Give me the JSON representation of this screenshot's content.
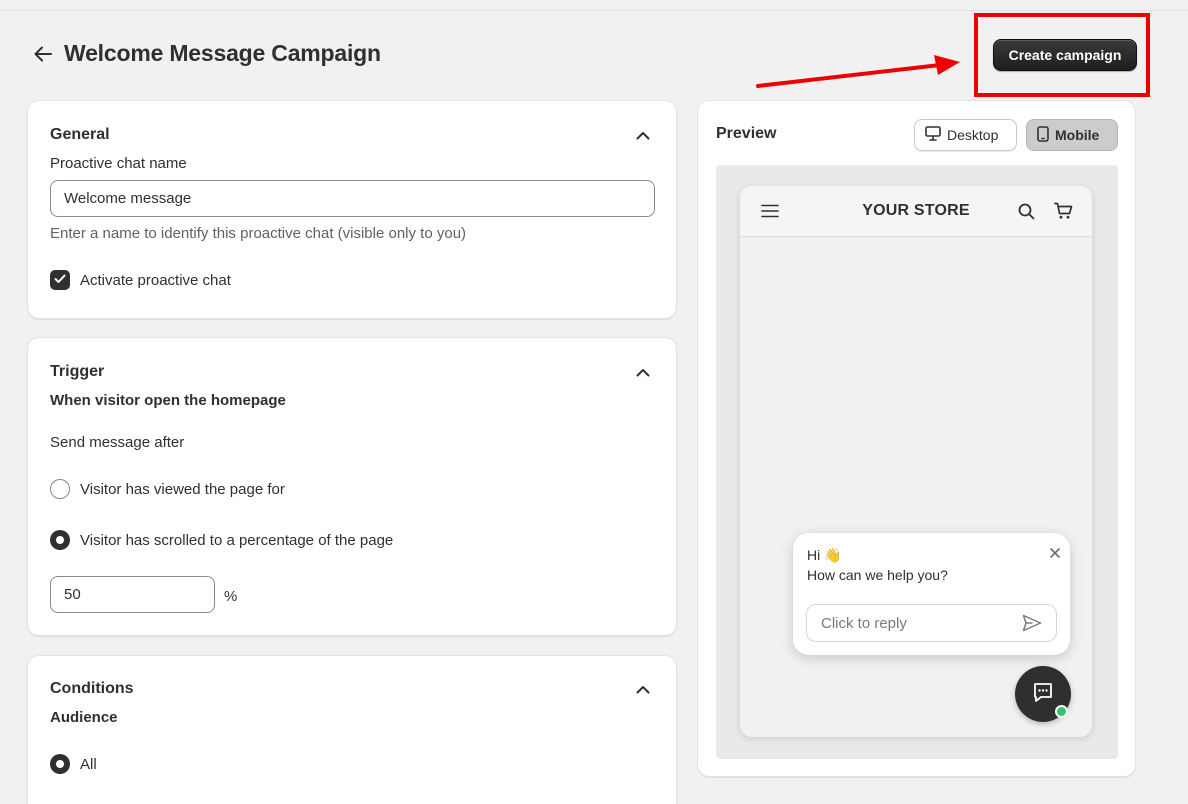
{
  "header": {
    "title": "Welcome Message Campaign",
    "create_button": "Create campaign"
  },
  "general": {
    "title": "General",
    "name_label": "Proactive chat name",
    "name_value": "Welcome message",
    "name_help": "Enter a name to identify this proactive chat (visible only to you)",
    "activate_label": "Activate proactive chat",
    "activate_checked": true
  },
  "trigger": {
    "title": "Trigger",
    "subtitle": "When visitor open the homepage",
    "send_after_label": "Send message after",
    "options": [
      {
        "label": "Visitor has viewed the page for",
        "selected": false
      },
      {
        "label": "Visitor has scrolled to a percentage of the page",
        "selected": true
      }
    ],
    "percent_value": "50",
    "percent_unit": "%"
  },
  "conditions": {
    "title": "Conditions",
    "audience_label": "Audience",
    "audience_options": [
      {
        "label": "All",
        "selected": true
      }
    ]
  },
  "preview": {
    "title": "Preview",
    "desktop_label": "Desktop",
    "mobile_label": "Mobile",
    "active_view": "Mobile",
    "store_name": "YOUR STORE",
    "chat": {
      "greeting_line1": "Hi 👋",
      "greeting_line2": "How can we help you?",
      "reply_placeholder": "Click to reply"
    }
  },
  "colors": {
    "highlight": "#ee0000",
    "primary_button": "#303030",
    "online": "#2fc76b"
  }
}
